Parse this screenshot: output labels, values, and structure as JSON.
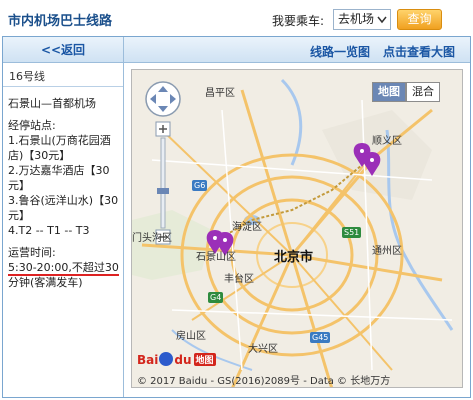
{
  "header": {
    "title": "市内机场巴士线路",
    "bus_label": "我要乘车:",
    "selected": "去机场",
    "query": "查询"
  },
  "nav": {
    "back": "<<返回",
    "route_overview": "线路一览图",
    "big_map": "点击查看大图"
  },
  "route": {
    "line": "16号线",
    "name": "石景山—首都机场",
    "stops_title": "经停站点:",
    "stops": [
      "1.石景山(万商花园酒店)【30元】",
      "2.万达嘉华酒店【30元】",
      "3.鲁谷(远洋山水)【30元】",
      "4.T2 -- T1 -- T3"
    ],
    "hours_title": "运营时间:",
    "hours": "5:30-20:00,不超过30",
    "hours_tail": "分钟(客满发车)"
  },
  "map": {
    "type_map": "地图",
    "type_mixed": "混合",
    "labels": {
      "changping": "昌平区",
      "shunyi": "顺义区",
      "haidian": "海淀区",
      "beijing": "北京市",
      "shijingshan": "石景山区",
      "mentougou": "门头沟区",
      "tongzhou": "通州区",
      "fengtai": "丰台区",
      "fangshan": "房山区",
      "daxing": "大兴区"
    },
    "road_signs": {
      "s51": "S51",
      "g4": "G4",
      "g45": "G45",
      "g6": "G6"
    },
    "logo_bai": "Bai",
    "logo_du": "du",
    "logo_map": "地图",
    "copyright": "© 2017 Baidu - GS(2016)2089号 - Data © 长地万方",
    "colors": {
      "ring_road": "#f4c36a",
      "water": "#a8c8ee",
      "pin": "#9b2fb8"
    },
    "icons": [
      "pan-control-icon",
      "zoom-in-icon",
      "zoom-out-icon",
      "map-pin-icon"
    ]
  }
}
